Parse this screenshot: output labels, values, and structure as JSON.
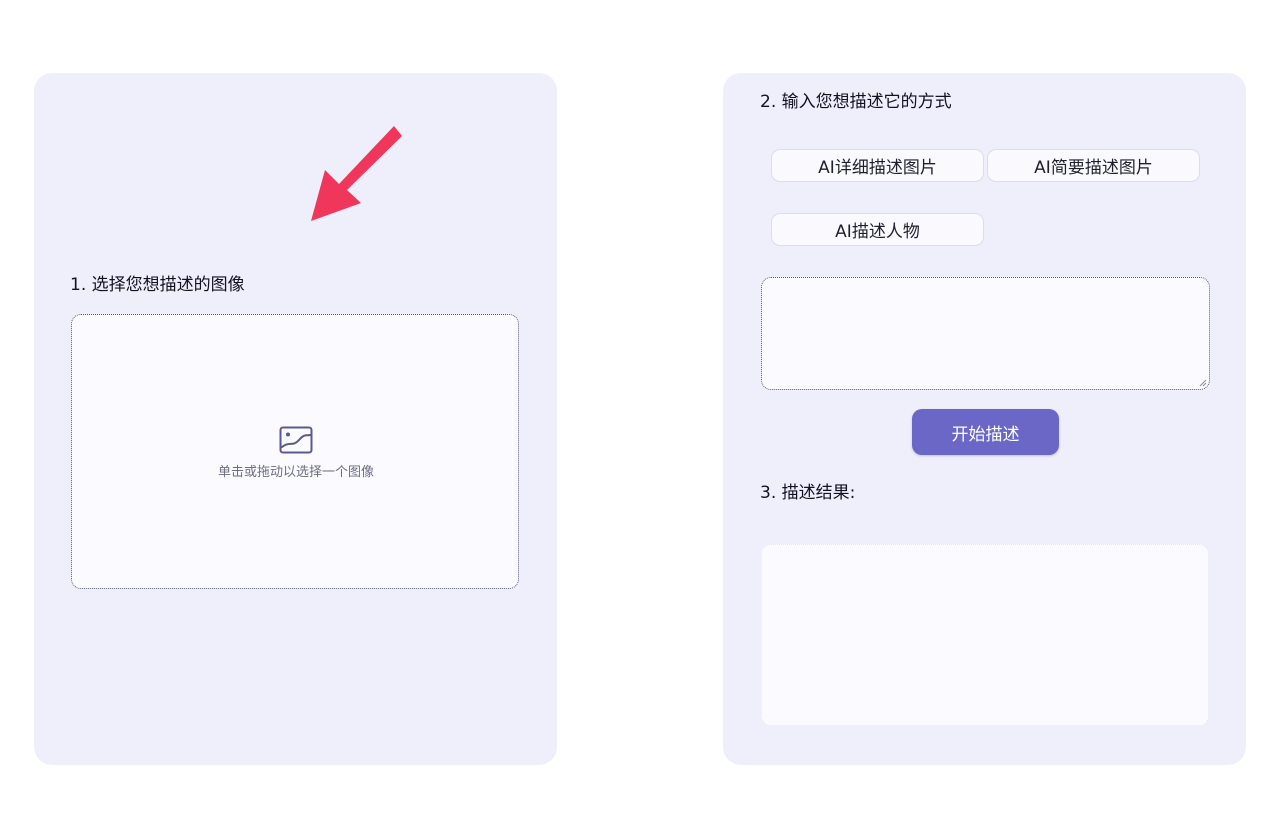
{
  "left": {
    "step_title": "1. 选择您想描述的图像",
    "upload_hint": "单击或拖动以选择一个图像",
    "upload_icon": "image-icon",
    "arrow_color": "#f0365a"
  },
  "right": {
    "step_title": "2. 输入您想描述它的方式",
    "modes": [
      {
        "label": "AI详细描述图片"
      },
      {
        "label": "AI简要描述图片"
      },
      {
        "label": "AI描述人物"
      }
    ],
    "prompt_value": "",
    "start_label": "开始描述",
    "result_title": "3. 描述结果:",
    "result_value": ""
  },
  "colors": {
    "panel_bg": "#efeefb",
    "accent": "#6a67c7"
  }
}
